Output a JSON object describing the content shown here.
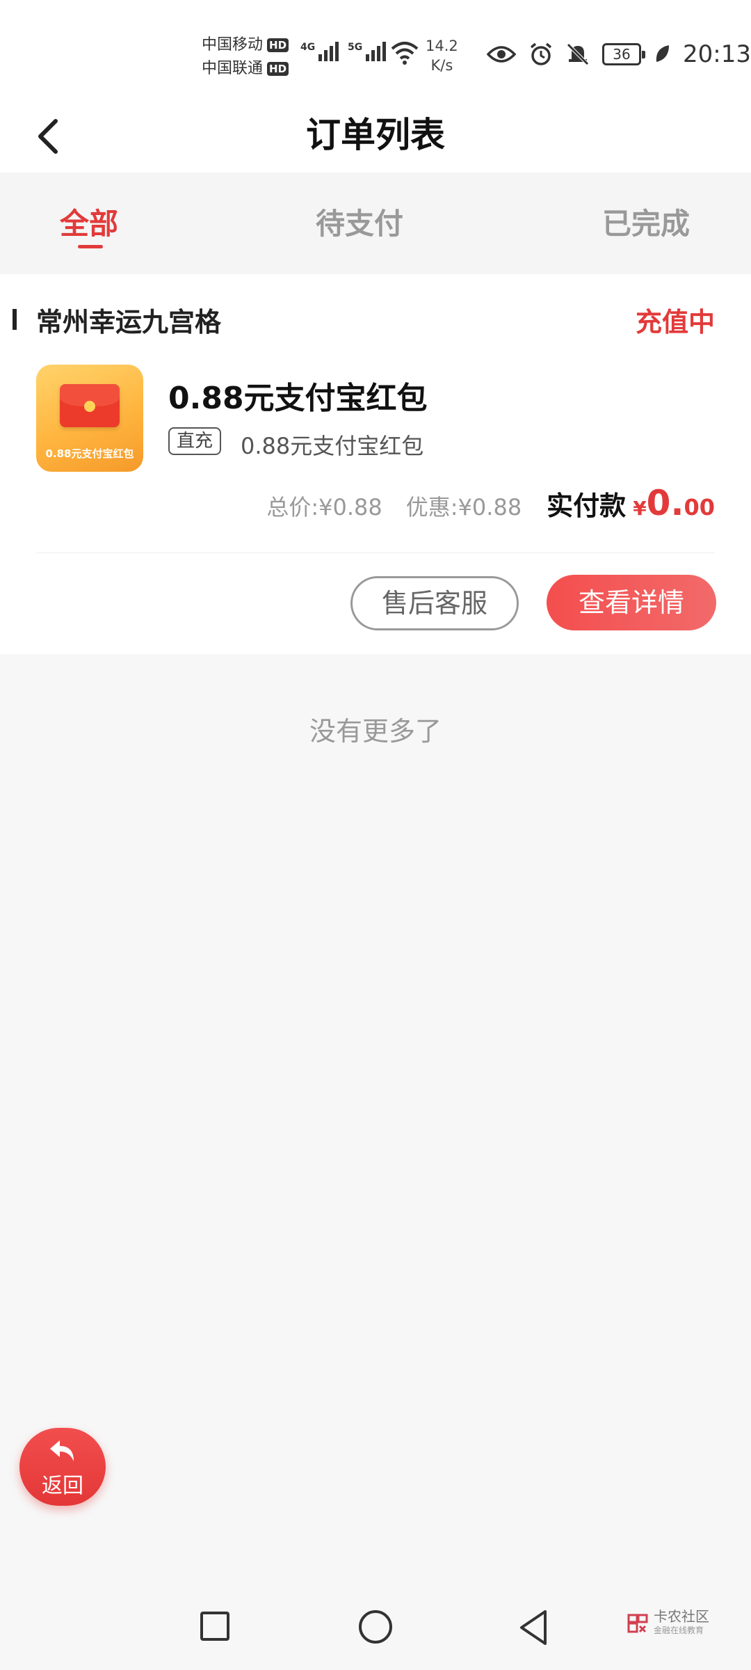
{
  "status_bar": {
    "carrier1": "中国移动",
    "carrier2": "中国联通",
    "hd": "HD",
    "sig1_label": "4G",
    "sig2_label": "5G",
    "net_speed_value": "14.2",
    "net_speed_unit": "K/s",
    "battery": "36",
    "time": "20:13"
  },
  "header": {
    "title": "订单列表"
  },
  "tabs": [
    {
      "label": "全部",
      "active": true
    },
    {
      "label": "待支付",
      "active": false
    },
    {
      "label": "已完成",
      "active": false
    }
  ],
  "order": {
    "shop_name": "常州幸运九宫格",
    "status": "充值中",
    "thumbnail_text": "0.88元支付宝红包",
    "product_name": "0.88元支付宝红包",
    "tag": "直充",
    "product_sub": "0.88元支付宝红包",
    "total_label": "总价:",
    "total_value": "¥0.88",
    "discount_label": "优惠:",
    "discount_value": "¥0.88",
    "paid_label": "实付款",
    "paid_currency": "¥",
    "paid_integer": "0.",
    "paid_decimal": "00",
    "after_sales_button": "售后客服",
    "details_button": "查看详情"
  },
  "no_more_text": "没有更多了",
  "return_button": {
    "label": "返回"
  },
  "watermark": {
    "title": "卡农社区",
    "subtitle": "金融在线教育"
  },
  "colors": {
    "accent": "#e23a3a",
    "background": "#f7f7f7"
  }
}
